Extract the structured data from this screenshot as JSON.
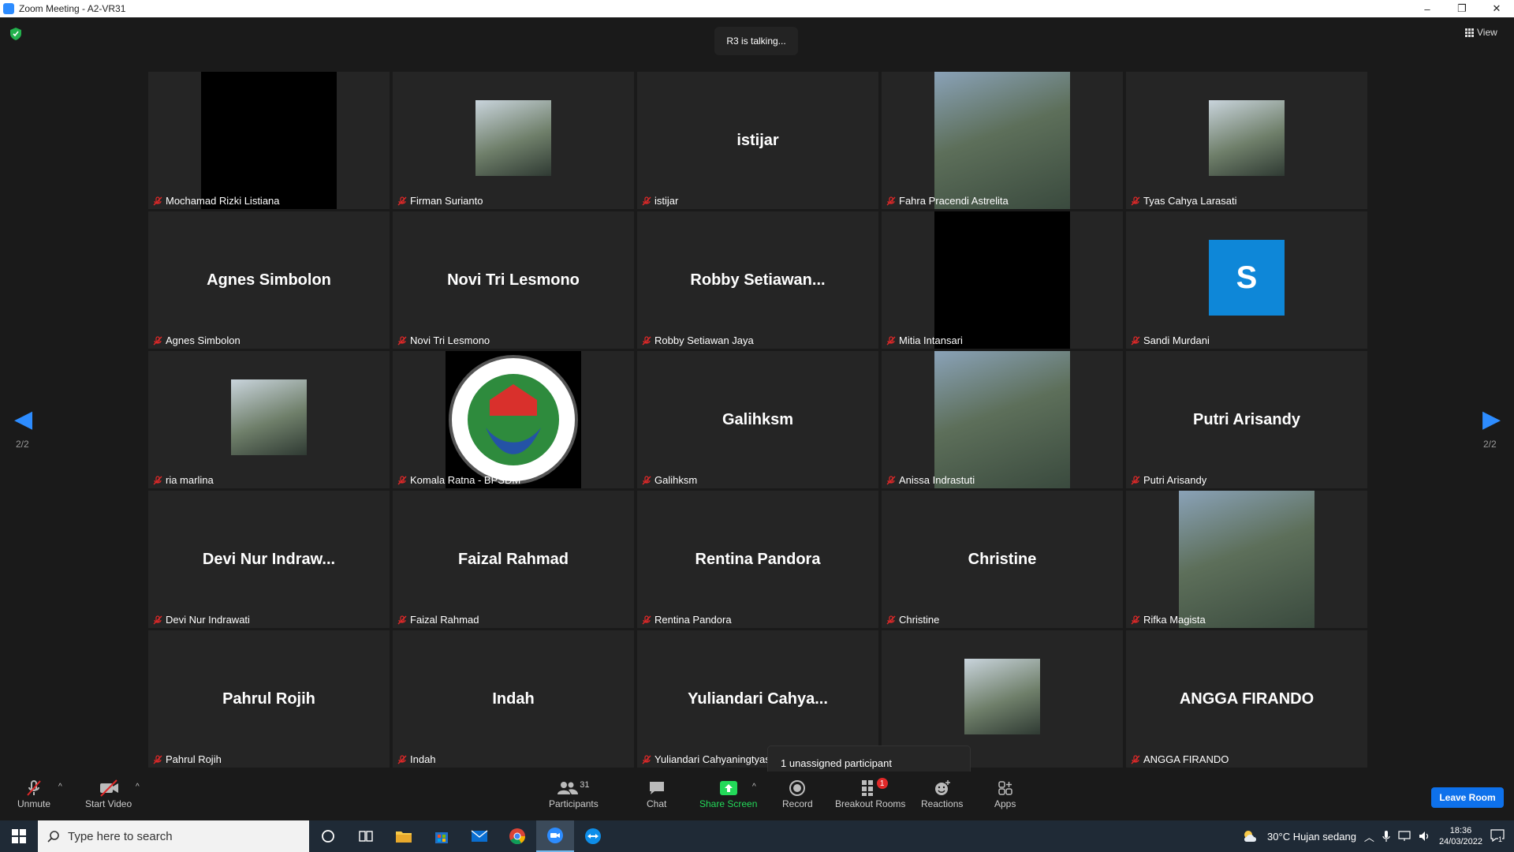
{
  "window": {
    "title": "Zoom Meeting - A2-VR31",
    "min": "–",
    "restore": "❐",
    "close": "✕"
  },
  "meeting": {
    "talking": "R3 is talking...",
    "view_label": "View",
    "page_left": "2/2",
    "page_right": "2/2",
    "tooltip": "1 unassigned participant",
    "tiles": [
      {
        "display": "",
        "label": "Mochamad Rizki Listiana",
        "media": "black"
      },
      {
        "display": "",
        "label": "Firman Surianto",
        "media": "small-photo"
      },
      {
        "display": "istijar",
        "label": "istijar",
        "media": "name"
      },
      {
        "display": "",
        "label": "Fahra Pracendi Astrelita",
        "media": "photo"
      },
      {
        "display": "",
        "label": "Tyas Cahya Larasati",
        "media": "small-photo"
      },
      {
        "display": "Agnes Simbolon",
        "label": "Agnes Simbolon",
        "media": "name"
      },
      {
        "display": "Novi Tri Lesmono",
        "label": "Novi Tri Lesmono",
        "media": "name"
      },
      {
        "display": "Robby  Setiawan...",
        "label": "Robby Setiawan Jaya",
        "media": "name"
      },
      {
        "display": "",
        "label": "Mitia Intansari",
        "media": "black"
      },
      {
        "display": "S",
        "label": "Sandi Murdani",
        "media": "avatar"
      },
      {
        "display": "",
        "label": "ria marlina",
        "media": "small-photo"
      },
      {
        "display": "",
        "label": "Komala Ratna - BPSDM",
        "media": "logo"
      },
      {
        "display": "Galihksm",
        "label": "Galihksm",
        "media": "name"
      },
      {
        "display": "",
        "label": "Anissa Indrastuti",
        "media": "photo"
      },
      {
        "display": "Putri Arisandy",
        "label": "Putri Arisandy",
        "media": "name"
      },
      {
        "display": "Devi Nur Indraw...",
        "label": "Devi Nur Indrawati",
        "media": "name"
      },
      {
        "display": "Faizal Rahmad",
        "label": "Faizal Rahmad",
        "media": "name"
      },
      {
        "display": "Rentina Pandora",
        "label": "Rentina Pandora",
        "media": "name"
      },
      {
        "display": "Christine",
        "label": "Christine",
        "media": "name"
      },
      {
        "display": "",
        "label": "Rifka Magista",
        "media": "photo"
      },
      {
        "display": "Pahrul Rojih",
        "label": "Pahrul Rojih",
        "media": "name"
      },
      {
        "display": "Indah",
        "label": "Indah",
        "media": "name"
      },
      {
        "display": "Yuliandari  Cahya...",
        "label": "Yuliandari Cahyaningtyas",
        "media": "name"
      },
      {
        "display": "",
        "label": "",
        "media": "small-photo"
      },
      {
        "display": "ANGGA FIRANDO",
        "label": "ANGGA FIRANDO",
        "media": "name"
      }
    ]
  },
  "toolbar": {
    "unmute": "Unmute",
    "start_video": "Start Video",
    "participants": "Participants",
    "participants_count": "31",
    "chat": "Chat",
    "share_screen": "Share Screen",
    "record": "Record",
    "breakout": "Breakout Rooms",
    "breakout_badge": "1",
    "reactions": "Reactions",
    "apps": "Apps",
    "leave": "Leave Room",
    "caret": "^"
  },
  "taskbar": {
    "search_placeholder": "Type here to search",
    "weather": "30°C  Hujan sedang",
    "time": "18:36",
    "date": "24/03/2022",
    "notifications": "1"
  },
  "colors": {
    "accent": "#2d8cff",
    "share_green": "#23d959",
    "avatar_blue": "#0e87d8",
    "leave_blue": "#0e71eb"
  }
}
